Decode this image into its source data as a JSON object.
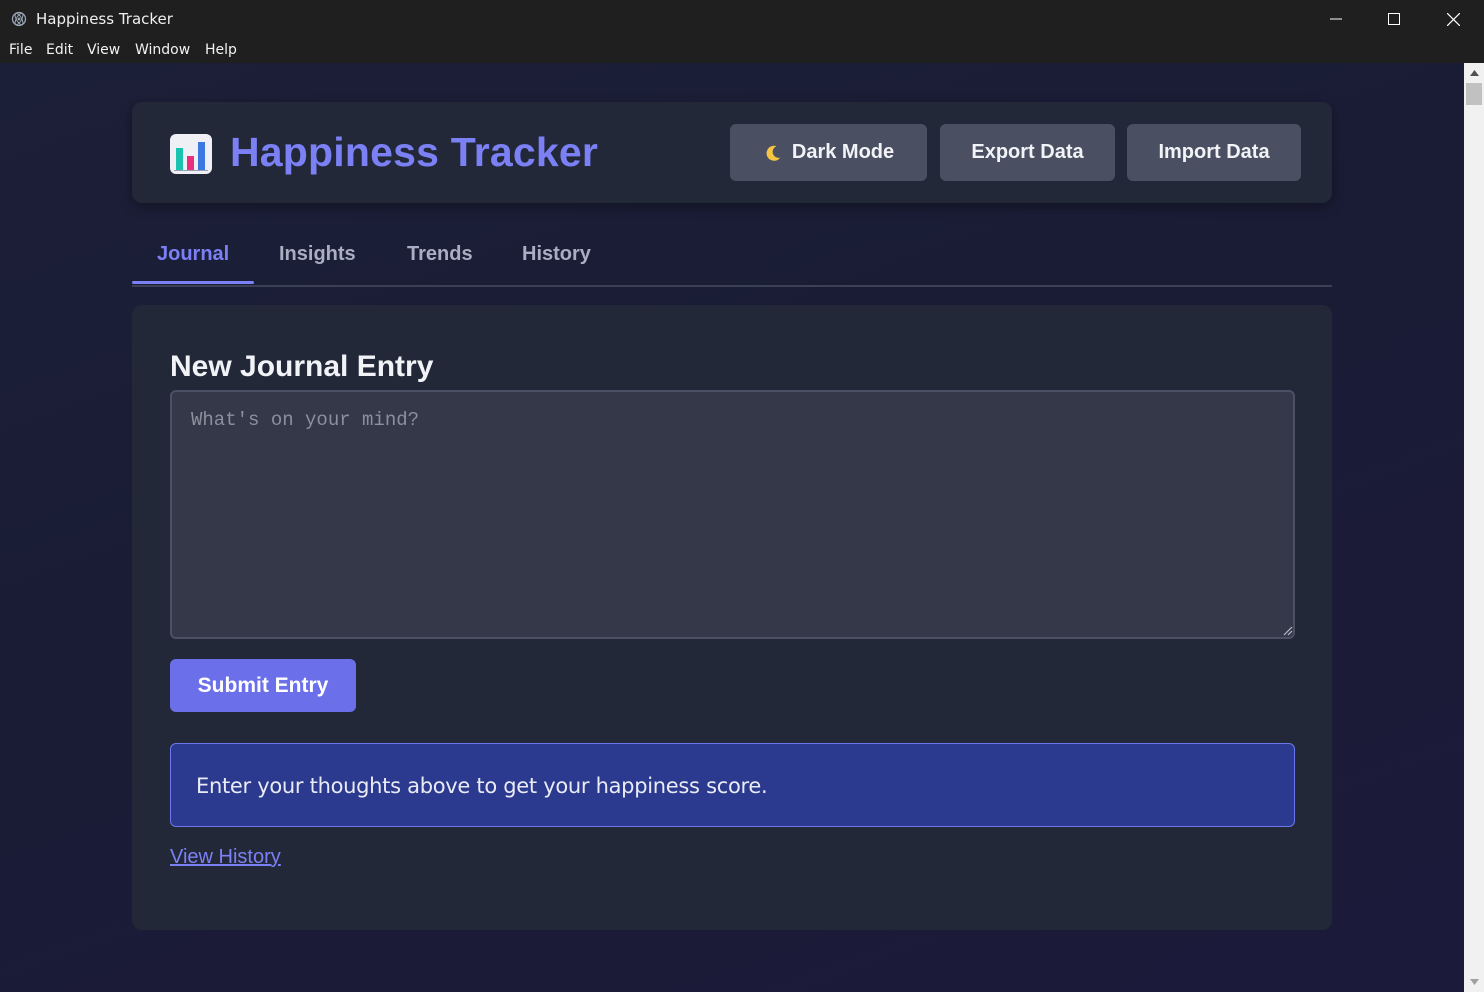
{
  "window": {
    "title": "Happiness Tracker",
    "controls": [
      "minimize-icon",
      "maximize-icon",
      "close-icon"
    ]
  },
  "menu": {
    "items": [
      "File",
      "Edit",
      "View",
      "Window",
      "Help"
    ]
  },
  "header": {
    "app_title": "Happiness Tracker",
    "logo_icon": "bar-chart-icon",
    "dark_mode_label": "Dark Mode",
    "dark_mode_icon": "moon-icon",
    "export_label": "Export Data",
    "import_label": "Import Data"
  },
  "tabs": {
    "items": [
      "Journal",
      "Insights",
      "Trends",
      "History"
    ],
    "active": "Journal"
  },
  "journal": {
    "heading": "New Journal Entry",
    "textarea_placeholder": "What's on your mind?",
    "textarea_value": "",
    "submit_label": "Submit Entry",
    "info_message": "Enter your thoughts above to get your happiness score.",
    "history_link": "View History"
  },
  "colors": {
    "accent": "#7b80f4",
    "button_primary": "#6b70ea",
    "card_bg": "#232839",
    "info_bg": "#2b3a8e"
  }
}
